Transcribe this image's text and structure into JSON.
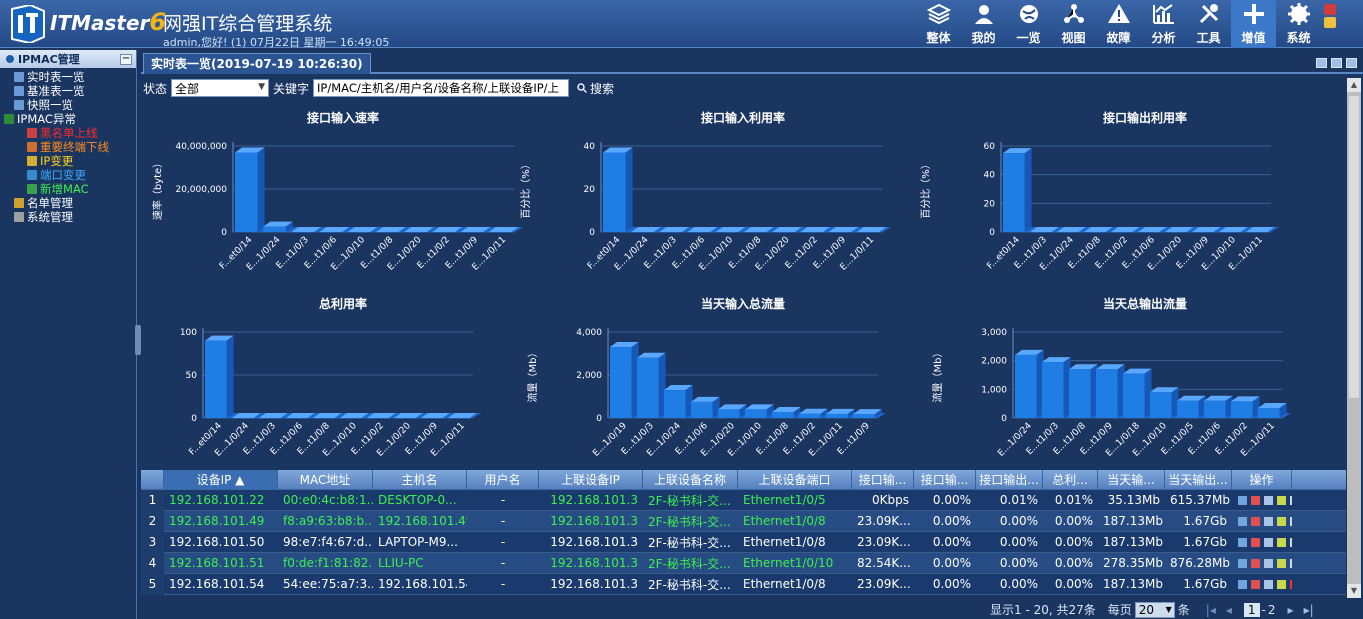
{
  "app": {
    "brand": "ITMaster",
    "version": "6",
    "title": "网强IT综合管理系统",
    "user_line": "admin,您好! (1) 07月22日 星期一 16:49:05"
  },
  "nav": [
    {
      "label": "整体",
      "icon": "layers-icon"
    },
    {
      "label": "我的",
      "icon": "user-icon"
    },
    {
      "label": "一览",
      "icon": "globe-icon"
    },
    {
      "label": "视图",
      "icon": "topology-icon"
    },
    {
      "label": "故障",
      "icon": "warning-icon"
    },
    {
      "label": "分析",
      "icon": "chart-icon"
    },
    {
      "label": "工具",
      "icon": "tools-icon"
    },
    {
      "label": "增值",
      "icon": "plus-icon"
    },
    {
      "label": "系统",
      "icon": "gear-icon"
    }
  ],
  "colors": {
    "accent": "#3b78c8",
    "header": "#2c5491",
    "bar": "#1f7de6",
    "green": "#3df04e"
  },
  "sidebar": {
    "title": "IPMAC管理",
    "items": [
      {
        "label": "实时表一览",
        "color": "#ffffff",
        "level": 1
      },
      {
        "label": "基准表一览",
        "color": "#ffffff",
        "level": 1
      },
      {
        "label": "快照一览",
        "color": "#ffffff",
        "level": 1
      },
      {
        "label": "IPMAC异常",
        "color": "#ffffff",
        "level": 0
      },
      {
        "label": "黑名单上线",
        "color": "#ff2a2a",
        "level": 2
      },
      {
        "label": "重要终端下线",
        "color": "#ff8c1a",
        "level": 2
      },
      {
        "label": "IP变更",
        "color": "#ffd21a",
        "level": 2
      },
      {
        "label": "端口变更",
        "color": "#3aa7ff",
        "level": 2
      },
      {
        "label": "新增MAC",
        "color": "#3df04e",
        "level": 2
      },
      {
        "label": "名单管理",
        "color": "#ffffff",
        "level": 1
      },
      {
        "label": "系统管理",
        "color": "#ffffff",
        "level": 1
      }
    ]
  },
  "tab": {
    "label": "实时表一览(2019-07-19 10:26:30)"
  },
  "filter": {
    "status_label": "状态",
    "status_value": "全部",
    "keyword_label": "关键字",
    "keyword_value": "IP/MAC/主机名/用户名/设备名称/上联设备IP/上",
    "search_label": "搜索"
  },
  "chart_data": [
    {
      "type": "bar",
      "title": "接口输入速率",
      "ylabel": "速率（byte）",
      "ylim": [
        0,
        40000000
      ],
      "ticks": [
        "0",
        "20,000,000",
        "40,000,000"
      ],
      "categories": [
        "F...et0/14",
        "E...1/0/24",
        "E...t1/0/3",
        "E...t1/0/6",
        "E...1/0/10",
        "E...t1/0/8",
        "E...1/0/20",
        "E...t1/0/2",
        "E...t1/0/9",
        "E...1/0/11"
      ],
      "values": [
        37000000,
        2500000,
        0,
        0,
        0,
        0,
        0,
        0,
        0,
        0
      ]
    },
    {
      "type": "bar",
      "title": "接口输入利用率",
      "ylabel": "百分比（%）",
      "ylim": [
        0,
        40
      ],
      "ticks": [
        "0",
        "20",
        "40"
      ],
      "categories": [
        "F...et0/14",
        "E...1/0/24",
        "E...t1/0/3",
        "E...t1/0/6",
        "E...1/0/10",
        "E...t1/0/8",
        "E...1/0/20",
        "E...t1/0/2",
        "E...t1/0/9",
        "E...1/0/11"
      ],
      "values": [
        37,
        0,
        0,
        0,
        0,
        0,
        0,
        0,
        0,
        0
      ]
    },
    {
      "type": "bar",
      "title": "接口输出利用率",
      "ylabel": "百分比（%）",
      "ylim": [
        0,
        60
      ],
      "ticks": [
        "0",
        "20",
        "40",
        "60"
      ],
      "categories": [
        "F...et0/14",
        "E...t1/0/3",
        "E...1/0/24",
        "E...t1/0/8",
        "E...t1/0/2",
        "E...t1/0/6",
        "E...1/0/20",
        "E...t1/0/9",
        "E...1/0/10",
        "E...1/0/11"
      ],
      "values": [
        55,
        0,
        0,
        0,
        0,
        0,
        0,
        0,
        0,
        0
      ]
    },
    {
      "type": "bar",
      "title": "总利用率",
      "ylabel": "百分比（%）",
      "ylim": [
        0,
        100
      ],
      "ticks": [
        "0",
        "50",
        "100"
      ],
      "categories": [
        "F...et0/14",
        "E...1/0/24",
        "E...t1/0/3",
        "E...t1/0/6",
        "E...t1/0/8",
        "E...1/0/10",
        "E...t1/0/2",
        "E...1/0/20",
        "E...t1/0/9",
        "E...1/0/11"
      ],
      "values": [
        90,
        0,
        0,
        0,
        0,
        0,
        0,
        0,
        0,
        0
      ]
    },
    {
      "type": "bar",
      "title": "当天输入总流量",
      "ylabel": "流量（Mb）",
      "ylim": [
        0,
        4000
      ],
      "ticks": [
        "0",
        "2,000",
        "4,000"
      ],
      "categories": [
        "E...1/0/19",
        "E...t1/0/3",
        "E...1/0/24",
        "E...t1/0/6",
        "E...1/0/20",
        "E...1/0/10",
        "E...t1/0/8",
        "E...t1/0/2",
        "E...1/0/11",
        "E...t1/0/9"
      ],
      "values": [
        3300,
        2800,
        1300,
        750,
        400,
        400,
        280,
        200,
        190,
        180
      ]
    },
    {
      "type": "bar",
      "title": "当天总输出流量",
      "ylabel": "流量（Mb）",
      "ylim": [
        0,
        3000
      ],
      "ticks": [
        "0",
        "1,000",
        "2,000",
        "3,000"
      ],
      "categories": [
        "E...1/0/24",
        "E...t1/0/3",
        "E...t1/0/8",
        "E...t1/0/9",
        "E...1/0/18",
        "E...1/0/10",
        "E...t1/0/5",
        "E...t1/0/6",
        "E...t1/0/2",
        "E...1/0/11"
      ],
      "values": [
        2200,
        1950,
        1700,
        1700,
        1550,
        900,
        600,
        600,
        580,
        350
      ]
    }
  ],
  "table": {
    "columns": [
      "设备IP ▲",
      "MAC地址",
      "主机名",
      "用户名",
      "上联设备IP",
      "上联设备名称",
      "上联设备端口",
      "接口输...",
      "接口输...",
      "接口输出...",
      "总利...",
      "当天输...",
      "当天输出...",
      "操作"
    ],
    "rows": [
      {
        "n": "1",
        "ip": "192.168.101.22",
        "mac": "00:e0:4c:b8:1...",
        "host": "DESKTOP-0...",
        "user": "-",
        "upip": "192.168.101.3",
        "upname": "2F-秘书科-交...",
        "port": "Ethernet1/0/5",
        "in_rate": "0Kbps",
        "in_util": "0.00%",
        "out_util": "0.01%",
        "total": "0.01%",
        "day_in": "35.13Mb",
        "day_out": "615.37Mb",
        "green": true
      },
      {
        "n": "2",
        "ip": "192.168.101.49",
        "mac": "f8:a9:63:b8:b...",
        "host": "192.168.101.49",
        "user": "-",
        "upip": "192.168.101.3",
        "upname": "2F-秘书科-交...",
        "port": "Ethernet1/0/8",
        "in_rate": "23.09K...",
        "in_util": "0.00%",
        "out_util": "0.00%",
        "total": "0.00%",
        "day_in": "187.13Mb",
        "day_out": "1.67Gb",
        "green": true
      },
      {
        "n": "3",
        "ip": "192.168.101.50",
        "mac": "98:e7:f4:67:d...",
        "host": "LAPTOP-M9...",
        "user": "-",
        "upip": "192.168.101.3",
        "upname": "2F-秘书科-交...",
        "port": "Ethernet1/0/8",
        "in_rate": "23.09K...",
        "in_util": "0.00%",
        "out_util": "0.00%",
        "total": "0.00%",
        "day_in": "187.13Mb",
        "day_out": "1.67Gb",
        "green": false
      },
      {
        "n": "4",
        "ip": "192.168.101.51",
        "mac": "f0:de:f1:81:82...",
        "host": "LLIU-PC",
        "user": "-",
        "upip": "192.168.101.3",
        "upname": "2F-秘书科-交...",
        "port": "Ethernet1/0/10",
        "in_rate": "82.54K...",
        "in_util": "0.00%",
        "out_util": "0.00%",
        "total": "0.00%",
        "day_in": "278.35Mb",
        "day_out": "876.28Mb",
        "green": true
      },
      {
        "n": "5",
        "ip": "192.168.101.54",
        "mac": "54:ee:75:a7:3...",
        "host": "192.168.101.54",
        "user": "-",
        "upip": "192.168.101.3",
        "upname": "2F-秘书科-交...",
        "port": "Ethernet1/0/8",
        "in_rate": "23.09K...",
        "in_util": "0.00%",
        "out_util": "0.00%",
        "total": "0.00%",
        "day_in": "187.13Mb",
        "day_out": "1.67Gb",
        "green": false
      }
    ]
  },
  "pager": {
    "summary": "显示1 - 20, 共27条",
    "per_page_label": "每页",
    "per_page": "20",
    "per_page_unit": "条",
    "pages": "1",
    "pages2": "2"
  }
}
